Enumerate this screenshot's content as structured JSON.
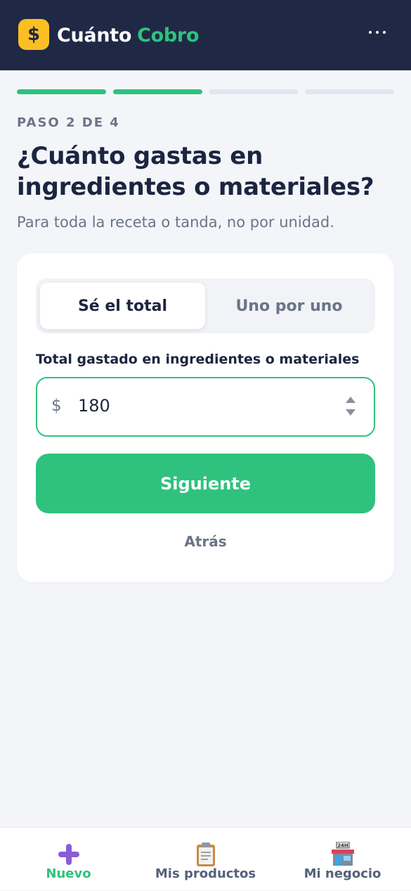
{
  "header": {
    "logo_symbol": "$",
    "brand_part1": "Cuánto",
    "brand_part2": "Cobro",
    "menu_icon": "more-horizontal-icon",
    "colors": {
      "bar": "#1f2945",
      "logo": "#fbbf24",
      "accent": "#2ec27e"
    }
  },
  "progress": {
    "current_step": 2,
    "total_steps": 4
  },
  "step_label": "PASO 2 DE 4",
  "question": {
    "title": "¿Cuánto gastas en ingredientes o materiales?",
    "subtitle": "Para toda la receta o tanda, no por unidad."
  },
  "card": {
    "mode_options": [
      {
        "label": "Sé el total",
        "selected": true
      },
      {
        "label": "Uno por uno",
        "selected": false
      }
    ],
    "field_label": "Total gastado en ingredientes o materiales",
    "currency_symbol": "$",
    "amount_value": "180",
    "next_button": "Siguiente",
    "back_link": "Atrás"
  },
  "bottom_nav": [
    {
      "label": "Nuevo",
      "icon": "plus-icon",
      "active": true
    },
    {
      "label": "Mis productos",
      "icon": "clipboard-icon",
      "active": false
    },
    {
      "label": "Mi negocio",
      "icon": "store-24h-icon",
      "active": false
    }
  ]
}
